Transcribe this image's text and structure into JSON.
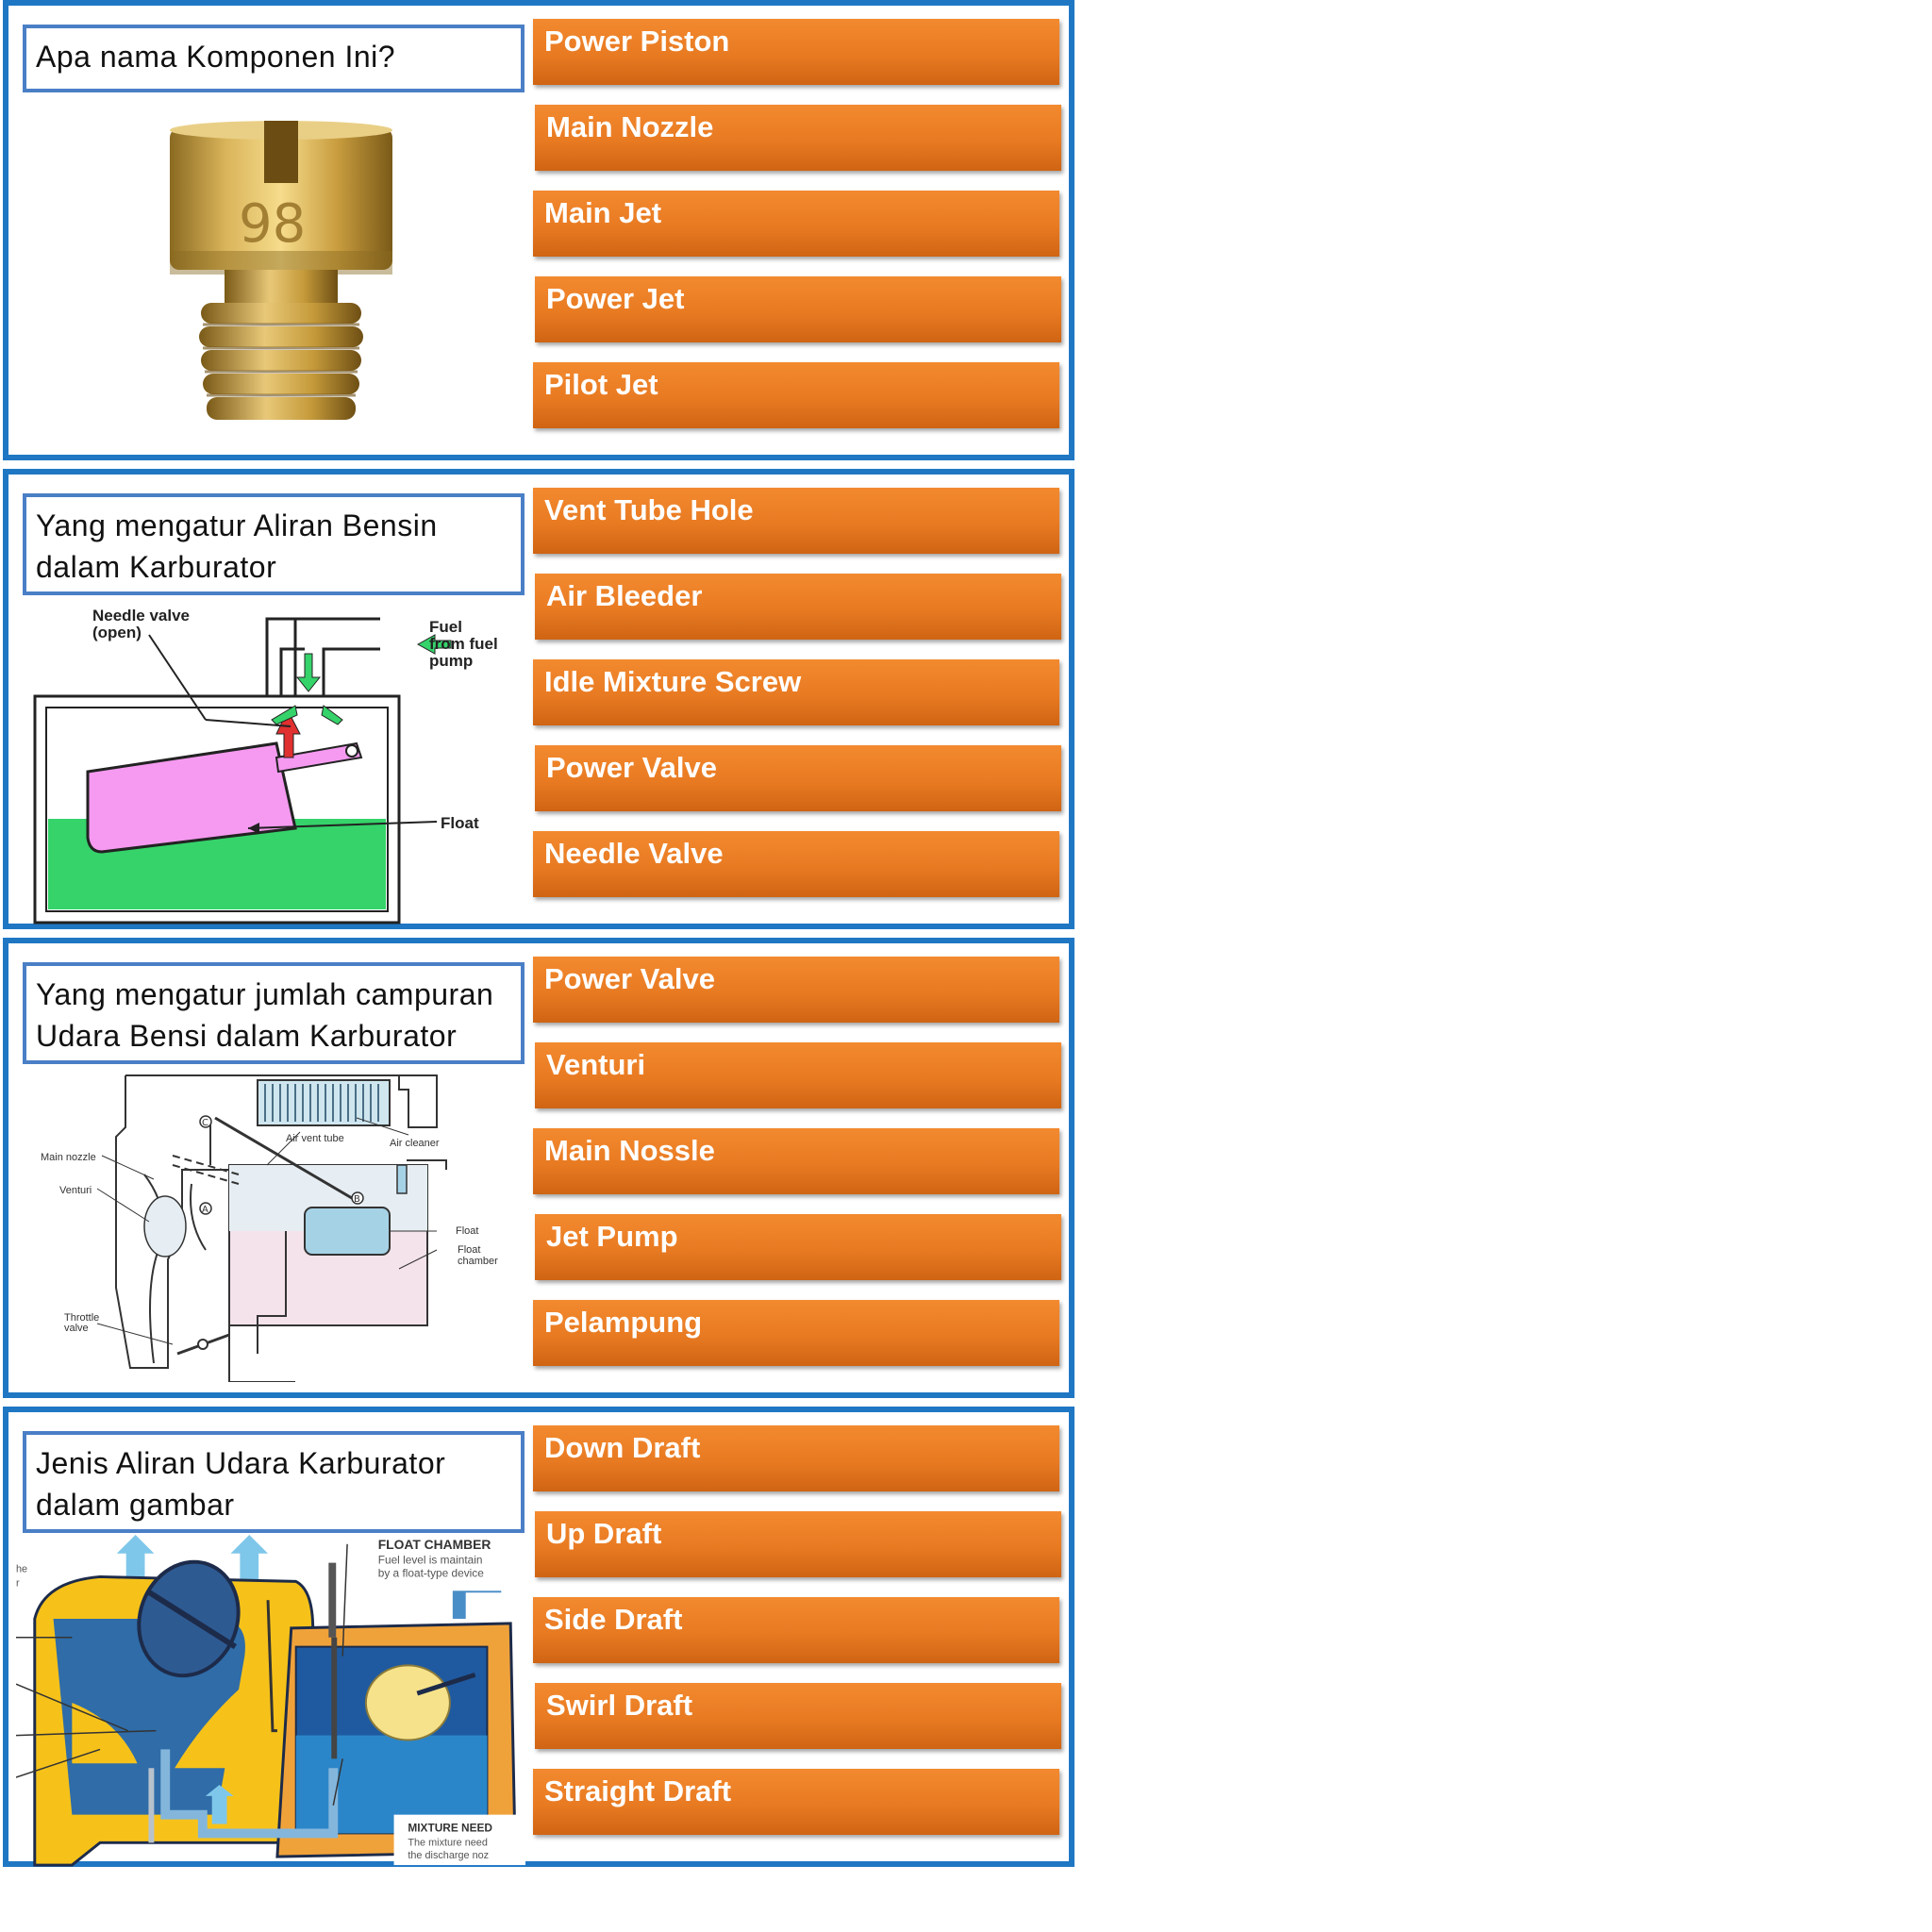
{
  "cards": [
    {
      "question": "Apa nama Komponen Ini?",
      "options": [
        "Power Piston",
        "Main Nozzle",
        "Main Jet",
        "Power Jet",
        "Pilot Jet"
      ],
      "figure": {
        "stamp": "98"
      }
    },
    {
      "question": "Yang mengatur Aliran Bensin dalam Karburator",
      "options": [
        "Vent Tube Hole",
        "Air Bleeder",
        "Idle Mixture Screw",
        "Power Valve",
        "Needle Valve"
      ],
      "figure": {
        "label_needle_1": "Needle valve",
        "label_needle_2": "(open)",
        "label_fuel_1": "Fuel",
        "label_fuel_2": "from fuel",
        "label_fuel_3": "pump",
        "label_float": "Float"
      }
    },
    {
      "question": "Yang mengatur jumlah campuran Udara Bensi dalam Karburator",
      "options": [
        "Power Valve",
        "Venturi",
        "Main Nossle",
        "Jet Pump",
        "Pelampung"
      ],
      "figure": {
        "label_air_vent": "Air vent tube",
        "label_air_cleaner": "Air cleaner",
        "label_main_nozzle": "Main nozzle",
        "label_venturi": "Venturi",
        "label_float": "Float",
        "label_float_chamber_1": "Float",
        "label_float_chamber_2": "chamber",
        "label_throttle_1": "Throttle",
        "label_throttle_2": "valve",
        "marker_a": "A",
        "marker_b": "B",
        "marker_c": "C"
      }
    },
    {
      "question": "Jenis Aliran Udara Karburator dalam gambar",
      "options": [
        "Down Draft",
        "Up Draft",
        "Side Draft",
        "Swirl Draft",
        "Straight Draft"
      ],
      "figure": {
        "label_float_chamber": "FLOAT CHAMBER",
        "label_float_desc_1": "Fuel level is maintain",
        "label_float_desc_2": "by a float-type device",
        "label_mixture": "MIXTURE NEED",
        "label_mixture_desc_1": "The mixture need",
        "label_mixture_desc_2": "the discharge noz",
        "label_edge_1": "he",
        "label_edge_2": "r"
      }
    }
  ]
}
